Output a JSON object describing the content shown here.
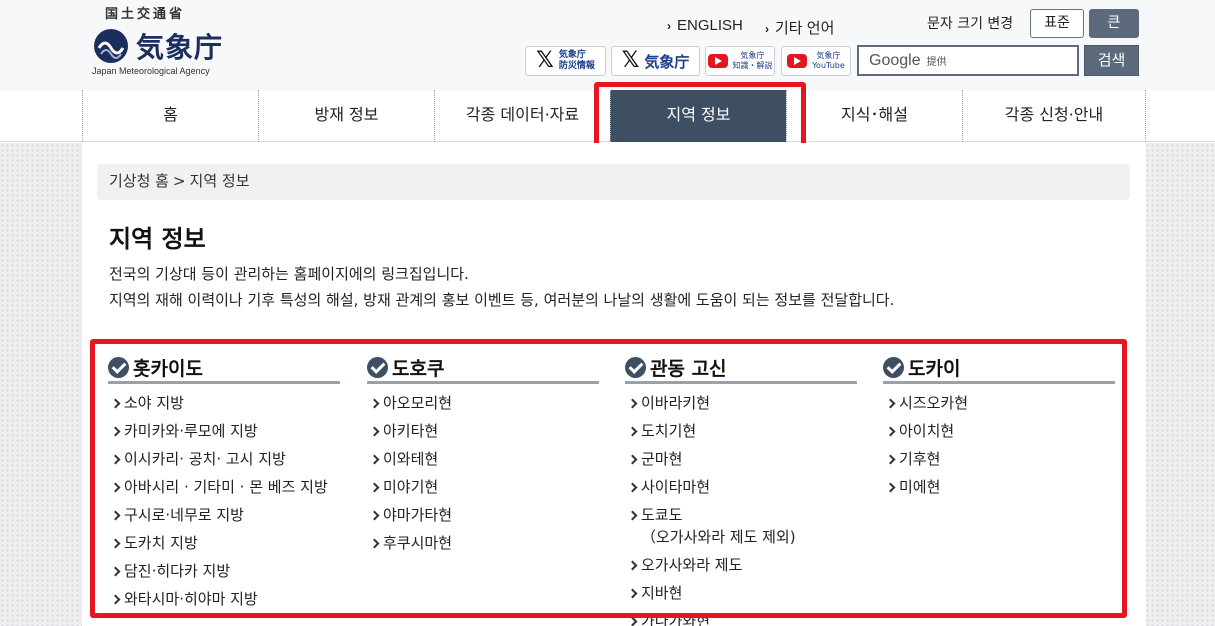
{
  "header": {
    "logo_sub": "国土交通省",
    "logo_main": "気象庁",
    "logo_en": "Japan Meteorological Agency",
    "english": "ENGLISH",
    "other_lang": "기타 언어",
    "font_size_label": "문자 크기 변경",
    "font_std": "표준",
    "font_large": "큰",
    "social": {
      "x_disaster": [
        "気象庁",
        "防災情報"
      ],
      "x_jma": "気象庁",
      "yt_knowledge": [
        "気象庁",
        "知識・解説"
      ],
      "yt_main": [
        "気象庁",
        "YouTube"
      ]
    },
    "search": {
      "brand": "Google",
      "provided": "提供",
      "button": "검색"
    }
  },
  "nav": [
    "홈",
    "방재 정보",
    "각종 데이터·자료",
    "지역 정보",
    "지식･해설",
    "각종 신청·안내"
  ],
  "nav_active_index": 3,
  "breadcrumb": {
    "home": "기상청 홈",
    "sep": ">",
    "current": "지역 정보"
  },
  "page": {
    "title": "지역 정보",
    "intro_1": "전국의 기상대 등이 관리하는 홈페이지에의 링크집입니다.",
    "intro_2": "지역의 재해 이력이나 기후 특성의 해설, 방재 관계의 홍보 이벤트 등, 여러분의 나날의 생활에 도움이 되는 정보를 전달합니다."
  },
  "regions": [
    {
      "title": "홋카이도",
      "items": [
        "소야 지방",
        "카미카와·루모에 지방",
        "이시카리· 공치· 고시 지방",
        "아바시리 · 기타미 · 몬 베즈 지방",
        "구시로·네무로 지방",
        "도카치 지방",
        "담진·히다카 지방",
        "와타시마·히야마 지방"
      ]
    },
    {
      "title": "도호쿠",
      "items": [
        "아오모리현",
        "아키타현",
        "이와테현",
        "미야기현",
        "야마가타현",
        "후쿠시마현"
      ]
    },
    {
      "title": "관동 고신",
      "items": [
        "이바라키현",
        "도치기현",
        "군마현",
        "사이타마현",
        "도쿄도\n（오가사와라 제도 제외)",
        "오가사와라 제도",
        "지바현",
        "가나가와현"
      ]
    },
    {
      "title": "도카이",
      "items": [
        "시즈오카현",
        "아이치현",
        "기후현",
        "미에현"
      ]
    }
  ],
  "colors": {
    "nav_active": "#3e4e63",
    "highlight": "#e5161f"
  }
}
